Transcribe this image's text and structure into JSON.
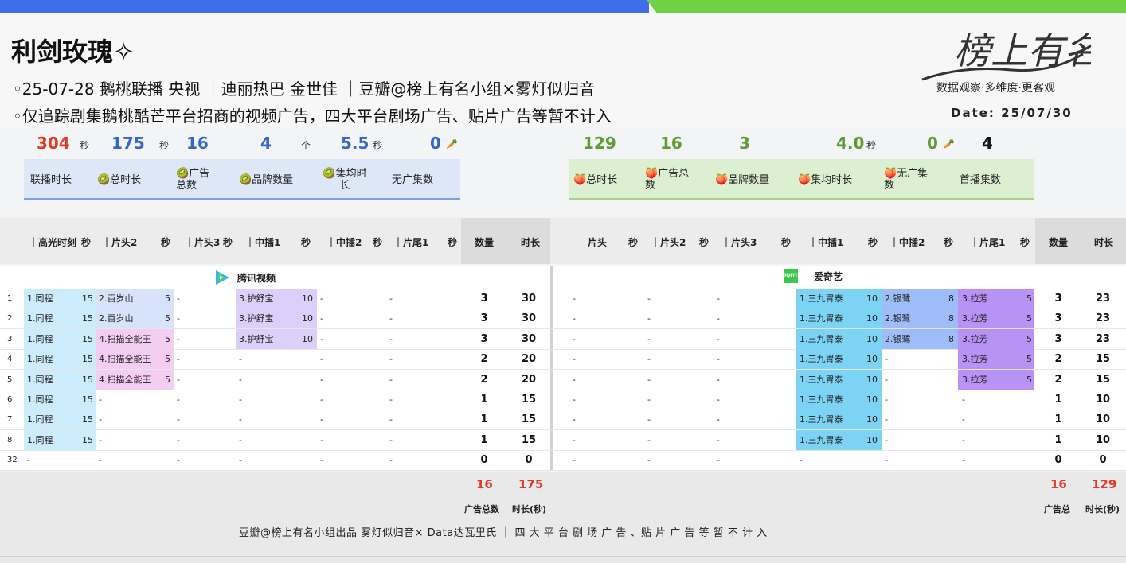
{
  "header": {
    "title": "利剑玫瑰✧",
    "line1": "◦25-07-28 鹅桃联播 央视 ｜迪丽热巴 金世佳 ｜豆瓣@榜上有名小组×雾灯似归音",
    "line2": "◦仅追踪剧集鹅桃酷芒平台招商的视频广告，四大平台剧场广告、贴片广告等暂不计入",
    "logo_text": "榜上有名",
    "logo_sub": "数据观察·多维度·更客观",
    "date": "Date: 25/07/30"
  },
  "stats_left": {
    "broadcast_len": "304",
    "broadcast_unit": "秒",
    "total_len": "175",
    "total_unit": "秒",
    "ad_total": "16",
    "brand_count": "4",
    "brand_unit": "个",
    "avg_len": "5.5",
    "avg_unit": "秒",
    "no_ad": "0",
    "labels": [
      "联播时长",
      "🥝总时长",
      "🥝广告总数",
      "🥝品牌数量",
      "🥝集均时长",
      "无广集数"
    ]
  },
  "stats_right": {
    "total_len": "129",
    "ad_total": "16",
    "brand_count": "3",
    "avg_len": "4.0",
    "avg_unit": "秒",
    "no_ad": "0",
    "first_ep": "4",
    "labels": [
      "🍑总时长",
      "🍑广告总数",
      "🍑品牌数量",
      "🍑集均时长",
      "🍑无广集数",
      "首播集数"
    ]
  },
  "table_head_left": [
    "｜高光时刻",
    "秒",
    "｜片头2",
    "秒",
    "｜片头3",
    "秒",
    "｜中插1",
    "秒",
    "｜中插2",
    "秒",
    "｜片尾1",
    "秒",
    "数量",
    "时长"
  ],
  "table_head_right": [
    "片头",
    "秒",
    "｜片头2",
    "秒",
    "｜片头3",
    "秒",
    "｜中插1",
    "秒",
    "｜中插2",
    "秒",
    "｜片尾1",
    "秒",
    "数量",
    "时长"
  ],
  "platform_left": "腾讯视频",
  "platform_right": "爱奇艺",
  "platform_right_icon": "iQIYI",
  "rows": [
    {
      "ep": "1",
      "l": [
        [
          "1.同程",
          "15"
        ],
        [
          "2.百岁山",
          "5"
        ],
        [
          "-",
          ""
        ],
        [
          "3.护舒宝",
          "10"
        ],
        [
          "-",
          ""
        ],
        [
          "-",
          ""
        ]
      ],
      "lc": "3",
      "lt": "30",
      "r": [
        [
          "-",
          ""
        ],
        [
          "-",
          ""
        ],
        [
          "-",
          ""
        ],
        [
          "1.三九胃泰",
          "10"
        ],
        [
          "2.银鹭",
          "8"
        ],
        [
          "3.拉芳",
          "5"
        ]
      ],
      "rc": "3",
      "rt": "23"
    },
    {
      "ep": "2",
      "l": [
        [
          "1.同程",
          "15"
        ],
        [
          "2.百岁山",
          "5"
        ],
        [
          "-",
          ""
        ],
        [
          "3.护舒宝",
          "10"
        ],
        [
          "-",
          ""
        ],
        [
          "-",
          ""
        ]
      ],
      "lc": "3",
      "lt": "30",
      "r": [
        [
          "-",
          ""
        ],
        [
          "-",
          ""
        ],
        [
          "-",
          ""
        ],
        [
          "1.三九胃泰",
          "10"
        ],
        [
          "2.银鹭",
          "8"
        ],
        [
          "3.拉芳",
          "5"
        ]
      ],
      "rc": "3",
      "rt": "23"
    },
    {
      "ep": "3",
      "l": [
        [
          "1.同程",
          "15"
        ],
        [
          "4.扫描全能王",
          "5"
        ],
        [
          "-",
          ""
        ],
        [
          "3.护舒宝",
          "10"
        ],
        [
          "-",
          ""
        ],
        [
          "-",
          ""
        ]
      ],
      "lc": "3",
      "lt": "30",
      "r": [
        [
          "-",
          ""
        ],
        [
          "-",
          ""
        ],
        [
          "-",
          ""
        ],
        [
          "1.三九胃泰",
          "10"
        ],
        [
          "2.银鹭",
          "8"
        ],
        [
          "3.拉芳",
          "5"
        ]
      ],
      "rc": "3",
      "rt": "23"
    },
    {
      "ep": "4",
      "l": [
        [
          "1.同程",
          "15"
        ],
        [
          "4.扫描全能王",
          "5"
        ],
        [
          "-",
          ""
        ],
        [
          "-",
          ""
        ],
        [
          "-",
          ""
        ],
        [
          "-",
          ""
        ]
      ],
      "lc": "2",
      "lt": "20",
      "r": [
        [
          "-",
          ""
        ],
        [
          "-",
          ""
        ],
        [
          "-",
          ""
        ],
        [
          "1.三九胃泰",
          "10"
        ],
        [
          "-",
          ""
        ],
        [
          "3.拉芳",
          "5"
        ]
      ],
      "rc": "2",
      "rt": "15"
    },
    {
      "ep": "5",
      "l": [
        [
          "1.同程",
          "15"
        ],
        [
          "4.扫描全能王",
          "5"
        ],
        [
          "-",
          ""
        ],
        [
          "-",
          ""
        ],
        [
          "-",
          ""
        ],
        [
          "-",
          ""
        ]
      ],
      "lc": "2",
      "lt": "20",
      "r": [
        [
          "-",
          ""
        ],
        [
          "-",
          ""
        ],
        [
          "-",
          ""
        ],
        [
          "1.三九胃泰",
          "10"
        ],
        [
          "-",
          ""
        ],
        [
          "3.拉芳",
          "5"
        ]
      ],
      "rc": "2",
      "rt": "15"
    },
    {
      "ep": "6",
      "l": [
        [
          "1.同程",
          "15"
        ],
        [
          "-",
          ""
        ],
        [
          "-",
          ""
        ],
        [
          "-",
          ""
        ],
        [
          "-",
          ""
        ],
        [
          "-",
          ""
        ]
      ],
      "lc": "1",
      "lt": "15",
      "r": [
        [
          "-",
          ""
        ],
        [
          "-",
          ""
        ],
        [
          "-",
          ""
        ],
        [
          "1.三九胃泰",
          "10"
        ],
        [
          "-",
          ""
        ],
        [
          "-",
          ""
        ]
      ],
      "rc": "1",
      "rt": "10"
    },
    {
      "ep": "7",
      "l": [
        [
          "1.同程",
          "15"
        ],
        [
          "-",
          ""
        ],
        [
          "-",
          ""
        ],
        [
          "-",
          ""
        ],
        [
          "-",
          ""
        ],
        [
          "-",
          ""
        ]
      ],
      "lc": "1",
      "lt": "15",
      "r": [
        [
          "-",
          ""
        ],
        [
          "-",
          ""
        ],
        [
          "-",
          ""
        ],
        [
          "1.三九胃泰",
          "10"
        ],
        [
          "-",
          ""
        ],
        [
          "-",
          ""
        ]
      ],
      "rc": "1",
      "rt": "10"
    },
    {
      "ep": "8",
      "l": [
        [
          "1.同程",
          "15"
        ],
        [
          "-",
          ""
        ],
        [
          "-",
          ""
        ],
        [
          "-",
          ""
        ],
        [
          "-",
          ""
        ],
        [
          "-",
          ""
        ]
      ],
      "lc": "1",
      "lt": "15",
      "r": [
        [
          "-",
          ""
        ],
        [
          "-",
          ""
        ],
        [
          "-",
          ""
        ],
        [
          "1.三九胃泰",
          "10"
        ],
        [
          "-",
          ""
        ],
        [
          "-",
          ""
        ]
      ],
      "rc": "1",
      "rt": "10"
    },
    {
      "ep": "32",
      "l": [
        [
          "-",
          ""
        ],
        [
          "-",
          ""
        ],
        [
          "-",
          ""
        ],
        [
          "-",
          ""
        ],
        [
          "-",
          ""
        ],
        [
          "-",
          ""
        ]
      ],
      "lc": "0",
      "lt": "0",
      "r": [
        [
          "-",
          ""
        ],
        [
          "-",
          ""
        ],
        [
          "-",
          ""
        ],
        [
          "-",
          ""
        ],
        [
          "-",
          ""
        ],
        [
          "-",
          ""
        ]
      ],
      "rc": "0",
      "rt": "0"
    }
  ],
  "footer": {
    "left_count": "16",
    "left_total": "175",
    "left_count_label": "广告总数",
    "left_total_label": "时长(秒)",
    "right_count": "16",
    "right_total": "129",
    "right_count_label": "广告总",
    "right_total_label": "时长(秒)",
    "credit": "豆瓣@榜上有名小组出品 雾灯似归音× Data达瓦里氏 ｜ 四 大 平 台 剧 场 广 告 、贴 片 广 告 等 暂 不 计 入"
  },
  "colors": {
    "accent_blue": "#3e6fe8",
    "accent_green": "#6fd244",
    "highlight_red": "#e23a26"
  }
}
